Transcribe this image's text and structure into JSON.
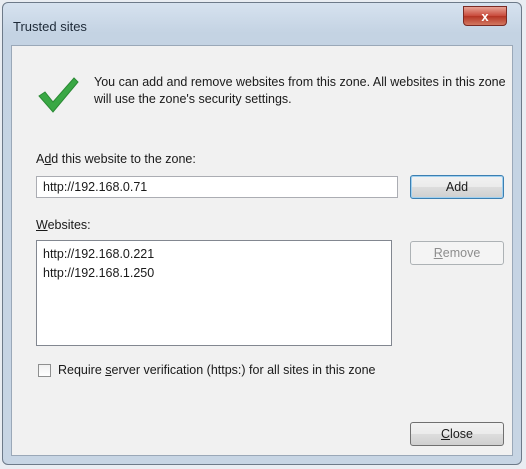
{
  "window": {
    "title": "Trusted sites",
    "close_glyph": "x"
  },
  "info": {
    "icon": "green-checkmark-icon",
    "text": "You can add and remove websites from this zone. All websites in this zone will use the zone's security settings."
  },
  "add_section": {
    "label_prefix": "A",
    "label_accel": "d",
    "label_rest": "d this website to the zone:",
    "input_value": "http://192.168.0.71",
    "add_button": "Add"
  },
  "websites_section": {
    "label_accel": "W",
    "label_rest": "ebsites:",
    "items": [
      "http://192.168.0.221",
      "http://192.168.1.250"
    ],
    "remove_accel": "R",
    "remove_rest": "emove"
  },
  "https_option": {
    "checked": false,
    "label_before": "Require ",
    "label_accel": "s",
    "label_after": "erver verification (https:) for all sites in this zone"
  },
  "close_button": {
    "accel": "C",
    "rest": "lose"
  },
  "colors": {
    "check_green": "#3aa845",
    "title_bar": "#c4d3e3",
    "close_red": "#c8493a"
  }
}
